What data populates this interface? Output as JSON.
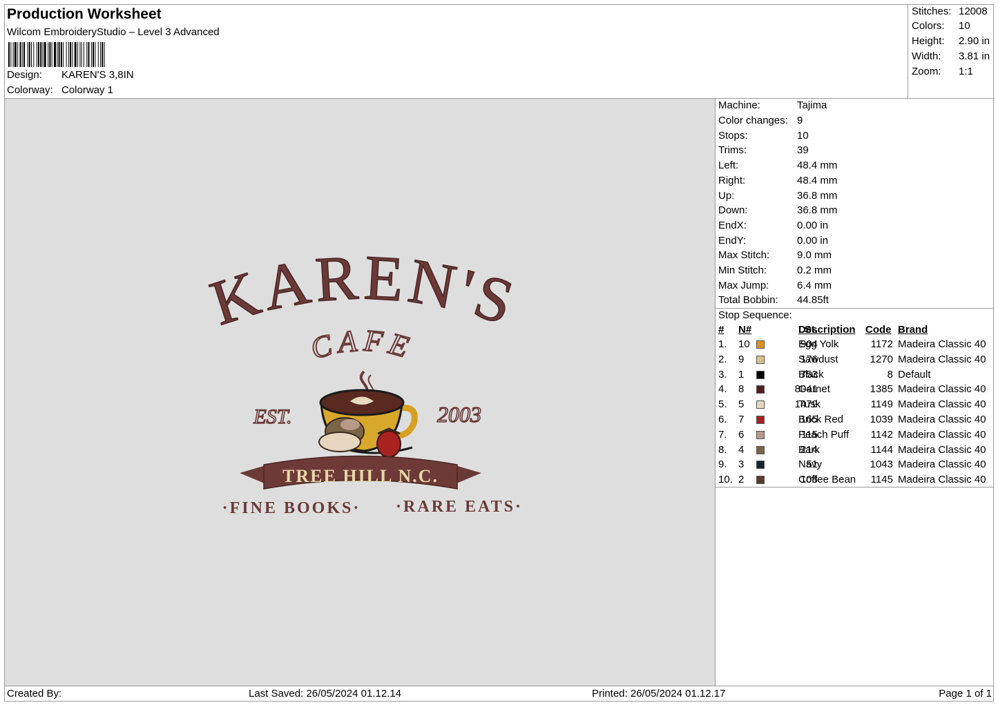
{
  "header": {
    "title": "Production Worksheet",
    "software": "Wilcom EmbroideryStudio – Level 3 Advanced",
    "design_label": "Design:",
    "design_value": "KAREN'S 3,8IN",
    "colorway_label": "Colorway:",
    "colorway_value": "Colorway 1"
  },
  "stats": [
    {
      "label": "Stitches:",
      "value": "12008"
    },
    {
      "label": "Colors:",
      "value": "10"
    },
    {
      "label": "Height:",
      "value": "2.90 in"
    },
    {
      "label": "Width:",
      "value": "3.81 in"
    },
    {
      "label": "Zoom:",
      "value": "1:1"
    }
  ],
  "info": [
    {
      "label": "Machine:",
      "value": "Tajima"
    },
    {
      "label": "Color changes:",
      "value": "9"
    },
    {
      "label": "Stops:",
      "value": "10"
    },
    {
      "label": "Trims:",
      "value": "39"
    },
    {
      "label": "Left:",
      "value": "48.4 mm"
    },
    {
      "label": "Right:",
      "value": "48.4 mm"
    },
    {
      "label": "Up:",
      "value": "36.8 mm"
    },
    {
      "label": "Down:",
      "value": "36.8 mm"
    },
    {
      "label": "EndX:",
      "value": "0.00 in"
    },
    {
      "label": "EndY:",
      "value": "0.00 in"
    },
    {
      "label": "Max Stitch:",
      "value": "9.0 mm"
    },
    {
      "label": "Min Stitch:",
      "value": "0.2 mm"
    },
    {
      "label": "Max Jump:",
      "value": "6.4 mm"
    },
    {
      "label": "Total Bobbin:",
      "value": "44.85ft"
    }
  ],
  "stop_sequence": {
    "title": "Stop Sequence:",
    "headers": {
      "idx": "#",
      "n": "N#",
      "st": "St.",
      "desc": "Description",
      "code": "Code",
      "brand": "Brand"
    },
    "rows": [
      {
        "idx": "1.",
        "n": "10",
        "color": "#e0901a",
        "st": "904",
        "desc": "Egg Yolk",
        "code": "1172",
        "brand": "Madeira Classic 40"
      },
      {
        "idx": "2.",
        "n": "9",
        "color": "#dcc08a",
        "st": "176",
        "desc": "Sawdust",
        "code": "1270",
        "brand": "Madeira Classic 40"
      },
      {
        "idx": "3.",
        "n": "1",
        "color": "#000000",
        "st": "753",
        "desc": "Black",
        "code": "8",
        "brand": "Default"
      },
      {
        "idx": "4.",
        "n": "8",
        "color": "#5a1a22",
        "st": "8041",
        "desc": "Garnet",
        "code": "1385",
        "brand": "Madeira Classic 40"
      },
      {
        "idx": "5.",
        "n": "5",
        "color": "#e6d6c0",
        "st": "1479",
        "desc": "Tusk",
        "code": "1149",
        "brand": "Madeira Classic 40"
      },
      {
        "idx": "6.",
        "n": "7",
        "color": "#a8231f",
        "st": "165",
        "desc": "Brick Red",
        "code": "1039",
        "brand": "Madeira Classic 40"
      },
      {
        "idx": "7.",
        "n": "6",
        "color": "#b89a8a",
        "st": "115",
        "desc": "Peach Puff",
        "code": "1142",
        "brand": "Madeira Classic 40"
      },
      {
        "idx": "8.",
        "n": "4",
        "color": "#7a6448",
        "st": "214",
        "desc": "Bark",
        "code": "1144",
        "brand": "Madeira Classic 40"
      },
      {
        "idx": "9.",
        "n": "3",
        "color": "#1c2230",
        "st": "51",
        "desc": "Navy",
        "code": "1043",
        "brand": "Madeira Classic 40"
      },
      {
        "idx": "10.",
        "n": "2",
        "color": "#5a3a28",
        "st": "108",
        "desc": "Coffee Bean",
        "code": "1145",
        "brand": "Madeira Classic 40"
      }
    ]
  },
  "design_art": {
    "line1": "KAREN'S",
    "line2": "CAFE",
    "est": "EST.",
    "year": "2003",
    "banner": "TREE HILL N.C.",
    "tagline_left": "·FINE BOOKS·",
    "tagline_right": "·RARE EATS·"
  },
  "footer": {
    "created_by": "Created By:",
    "last_saved": "Last Saved: 26/05/2024 01.12.14",
    "printed": "Printed: 26/05/2024 01.12.17",
    "page": "Page 1 of 1"
  }
}
